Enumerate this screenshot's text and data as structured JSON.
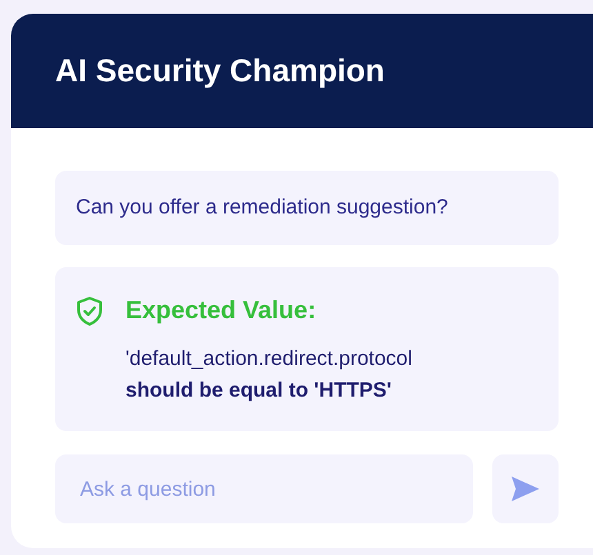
{
  "header": {
    "title": "AI Security Champion"
  },
  "messages": [
    {
      "kind": "question",
      "text": "Can you offer a remediation suggestion?"
    },
    {
      "kind": "answer",
      "heading": "Expected Value:",
      "text": "'default_action.redirect.protocol **should be equal to 'HTTPS'**"
    }
  ],
  "composer": {
    "placeholder": "Ask a question"
  }
}
